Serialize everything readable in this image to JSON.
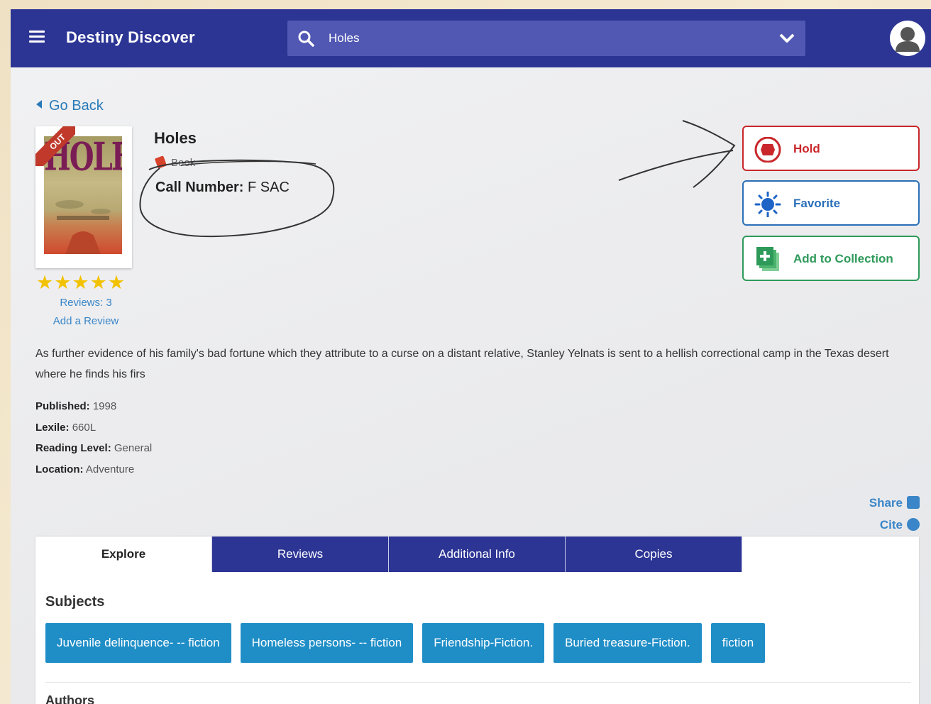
{
  "header": {
    "app_title": "Destiny Discover",
    "search_value": "Holes"
  },
  "nav": {
    "go_back": "Go Back"
  },
  "book": {
    "cover_title": "HOLES",
    "status_ribbon": "OUT",
    "title": "Holes",
    "format": "Book",
    "call_number_label": "Call Number:",
    "call_number_value": "F SAC",
    "rating_stars": 5,
    "reviews": "Reviews: 3",
    "add_review": "Add a Review",
    "summary": "As further evidence of his family's bad fortune which they attribute to a curse on a distant relative, Stanley Yelnats is sent to a hellish correctional camp in the Texas desert where he finds his firs"
  },
  "actions": {
    "hold": "Hold",
    "favorite": "Favorite",
    "add_to_collection": "Add to Collection"
  },
  "details": [
    {
      "label": "Published:",
      "value": "1998"
    },
    {
      "label": "Lexile:",
      "value": "660L"
    },
    {
      "label": "Reading Level:",
      "value": "General"
    },
    {
      "label": "Location:",
      "value": "Adventure"
    }
  ],
  "share": {
    "share_label": "Share",
    "cite_label": "Cite"
  },
  "tabs": [
    {
      "label": "Explore",
      "active": true
    },
    {
      "label": "Reviews",
      "active": false
    },
    {
      "label": "Additional Info",
      "active": false
    },
    {
      "label": "Copies",
      "active": false
    }
  ],
  "explore": {
    "subjects_heading": "Subjects",
    "subjects": [
      "Juvenile delinquence- -- fiction",
      "Homeless persons- -- fiction",
      "Friendship-Fiction.",
      "Buried treasure-Fiction.",
      "fiction"
    ],
    "authors_heading": "Authors"
  },
  "colors": {
    "header_bg": "#2c3594",
    "link_blue": "#3a86c8",
    "hold_red": "#c9272b",
    "favorite_blue": "#2a6fb8",
    "collection_green": "#2e9a5a",
    "chip_blue": "#1f8ec7"
  },
  "icons": [
    "menu-icon",
    "search-icon",
    "chevron-down-icon",
    "user-avatar-icon",
    "book-icon",
    "hold-icon",
    "favorite-star-icon",
    "add-to-collection-icon",
    "share-icon",
    "cite-icon"
  ]
}
